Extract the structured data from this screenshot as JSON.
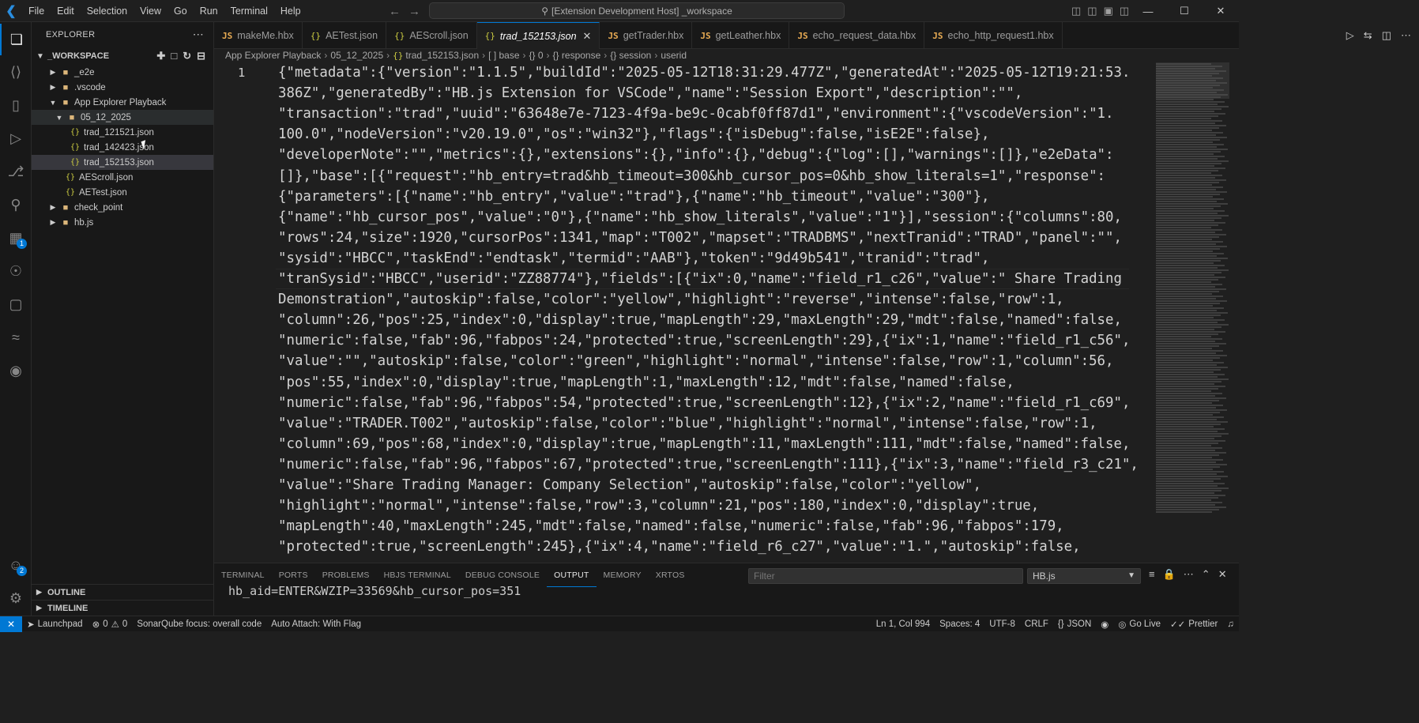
{
  "menu": [
    "File",
    "Edit",
    "Selection",
    "View",
    "Go",
    "Run",
    "Terminal",
    "Help"
  ],
  "search": {
    "label": "[Extension Development Host] _workspace"
  },
  "explorer": {
    "title": "EXPLORER",
    "workspace": "_WORKSPACE",
    "items": [
      {
        "label": "_e2e",
        "type": "folder",
        "expanded": false
      },
      {
        "label": ".vscode",
        "type": "folder",
        "expanded": false
      },
      {
        "label": "App Explorer Playback",
        "type": "folder",
        "expanded": true
      },
      {
        "label": "05_12_2025",
        "type": "folder",
        "expanded": true
      },
      {
        "label": "trad_121521.json",
        "type": "json"
      },
      {
        "label": "trad_142423.json",
        "type": "json"
      },
      {
        "label": "trad_152153.json",
        "type": "json"
      },
      {
        "label": "AEScroll.json",
        "type": "json"
      },
      {
        "label": "AETest.json",
        "type": "json"
      },
      {
        "label": "check_point",
        "type": "folder",
        "expanded": false
      },
      {
        "label": "hb.js",
        "type": "folder",
        "expanded": false
      }
    ],
    "outline": "OUTLINE",
    "timeline": "TIMELINE"
  },
  "activity_badges": {
    "extensions": "1",
    "accounts": "2"
  },
  "tabs": [
    {
      "label": "makeMe.hbx",
      "icon": "JS",
      "kind": "hbx"
    },
    {
      "label": "AETest.json",
      "icon": "{}",
      "kind": "json"
    },
    {
      "label": "AEScroll.json",
      "icon": "{}",
      "kind": "json"
    },
    {
      "label": "trad_152153.json",
      "icon": "{}",
      "kind": "json",
      "active": true
    },
    {
      "label": "getTrader.hbx",
      "icon": "JS",
      "kind": "hbx"
    },
    {
      "label": "getLeather.hbx",
      "icon": "JS",
      "kind": "hbx"
    },
    {
      "label": "echo_request_data.hbx",
      "icon": "JS",
      "kind": "hbx"
    },
    {
      "label": "echo_http_request1.hbx",
      "icon": "JS",
      "kind": "hbx"
    }
  ],
  "breadcrumb": [
    "App Explorer Playback",
    "05_12_2025",
    "trad_152153.json",
    "[ ] base",
    "{} 0",
    "{} response",
    "{} session",
    "userid"
  ],
  "editor": {
    "line_number": "1",
    "lines": [
      "{\"metadata\":{\"version\":\"1.1.5\",\"buildId\":\"2025-05-12T18:31:29.477Z\",\"generatedAt\":\"2025-05-12T19:21:53.",
      "386Z\",\"generatedBy\":\"HB.js Extension for VSCode\",\"name\":\"Session Export\",\"description\":\"\",",
      "\"transaction\":\"trad\",\"uuid\":\"63648e7e-7123-4f9a-be9c-0cabf0ff87d1\",\"environment\":{\"vscodeVersion\":\"1.",
      "100.0\",\"nodeVersion\":\"v20.19.0\",\"os\":\"win32\"},\"flags\":{\"isDebug\":false,\"isE2E\":false},",
      "\"developerNote\":\"\",\"metrics\":{},\"extensions\":{},\"info\":{},\"debug\":{\"log\":[],\"warnings\":[]},\"e2eData\":",
      "[]},\"base\":[{\"request\":\"hb_entry=trad&hb_timeout=300&hb_cursor_pos=0&hb_show_literals=1\",\"response\":",
      "{\"parameters\":[{\"name\":\"hb_entry\",\"value\":\"trad\"},{\"name\":\"hb_timeout\",\"value\":\"300\"},",
      "{\"name\":\"hb_cursor_pos\",\"value\":\"0\"},{\"name\":\"hb_show_literals\",\"value\":\"1\"}],\"session\":{\"columns\":80,",
      "\"rows\":24,\"size\":1920,\"cursorPos\":1341,\"map\":\"T002\",\"mapset\":\"TRADBMS\",\"nextTranid\":\"TRAD\",\"panel\":\"\",",
      "\"sysid\":\"HBCC\",\"taskEnd\":\"endtask\",\"termid\":\"AAB\"},\"token\":\"9d49b541\",\"tranid\":\"trad\",",
      "\"tranSysid\":\"HBCC\",\"userid\":\"ZZ88774\"},\"fields\":[{\"ix\":0,\"name\":\"field_r1_c26\",\"value\":\" Share Trading",
      "Demonstration\",\"autoskip\":false,\"color\":\"yellow\",\"highlight\":\"reverse\",\"intense\":false,\"row\":1,",
      "\"column\":26,\"pos\":25,\"index\":0,\"display\":true,\"mapLength\":29,\"maxLength\":29,\"mdt\":false,\"named\":false,",
      "\"numeric\":false,\"fab\":96,\"fabpos\":24,\"protected\":true,\"screenLength\":29},{\"ix\":1,\"name\":\"field_r1_c56\",",
      "\"value\":\"\",\"autoskip\":false,\"color\":\"green\",\"highlight\":\"normal\",\"intense\":false,\"row\":1,\"column\":56,",
      "\"pos\":55,\"index\":0,\"display\":true,\"mapLength\":1,\"maxLength\":12,\"mdt\":false,\"named\":false,",
      "\"numeric\":false,\"fab\":96,\"fabpos\":54,\"protected\":true,\"screenLength\":12},{\"ix\":2,\"name\":\"field_r1_c69\",",
      "\"value\":\"TRADER.T002\",\"autoskip\":false,\"color\":\"blue\",\"highlight\":\"normal\",\"intense\":false,\"row\":1,",
      "\"column\":69,\"pos\":68,\"index\":0,\"display\":true,\"mapLength\":11,\"maxLength\":111,\"mdt\":false,\"named\":false,",
      "\"numeric\":false,\"fab\":96,\"fabpos\":67,\"protected\":true,\"screenLength\":111},{\"ix\":3,\"name\":\"field_r3_c21\",",
      "\"value\":\"Share Trading Manager: Company Selection\",\"autoskip\":false,\"color\":\"yellow\",",
      "\"highlight\":\"normal\",\"intense\":false,\"row\":3,\"column\":21,\"pos\":180,\"index\":0,\"display\":true,",
      "\"mapLength\":40,\"maxLength\":245,\"mdt\":false,\"named\":false,\"numeric\":false,\"fab\":96,\"fabpos\":179,",
      "\"protected\":true,\"screenLength\":245},{\"ix\":4,\"name\":\"field_r6_c27\",\"value\":\"1.\",\"autoskip\":false,"
    ]
  },
  "panel": {
    "tabs": [
      "TERMINAL",
      "PORTS",
      "PROBLEMS",
      "HBJS TERMINAL",
      "DEBUG CONSOLE",
      "OUTPUT",
      "MEMORY",
      "XRTOS"
    ],
    "active_tab": "OUTPUT",
    "filter_placeholder": "Filter",
    "channel": "HB.js",
    "output": "hb_aid=ENTER&WZIP=33569&hb_cursor_pos=351"
  },
  "status": {
    "launchpad": "Launchpad",
    "errors": "0",
    "warnings": "0",
    "sonar": "SonarQube focus: overall code",
    "auto_attach": "Auto Attach: With Flag",
    "position": "Ln 1, Col 994",
    "spaces": "Spaces: 4",
    "encoding": "UTF-8",
    "eol": "CRLF",
    "language": "JSON",
    "go_live": "Go Live",
    "prettier": "Prettier"
  },
  "colors": {
    "accent": "#0078d4",
    "folder": "#dcb67a",
    "json": "#cbcb41",
    "hbx": "#e8ab53"
  }
}
